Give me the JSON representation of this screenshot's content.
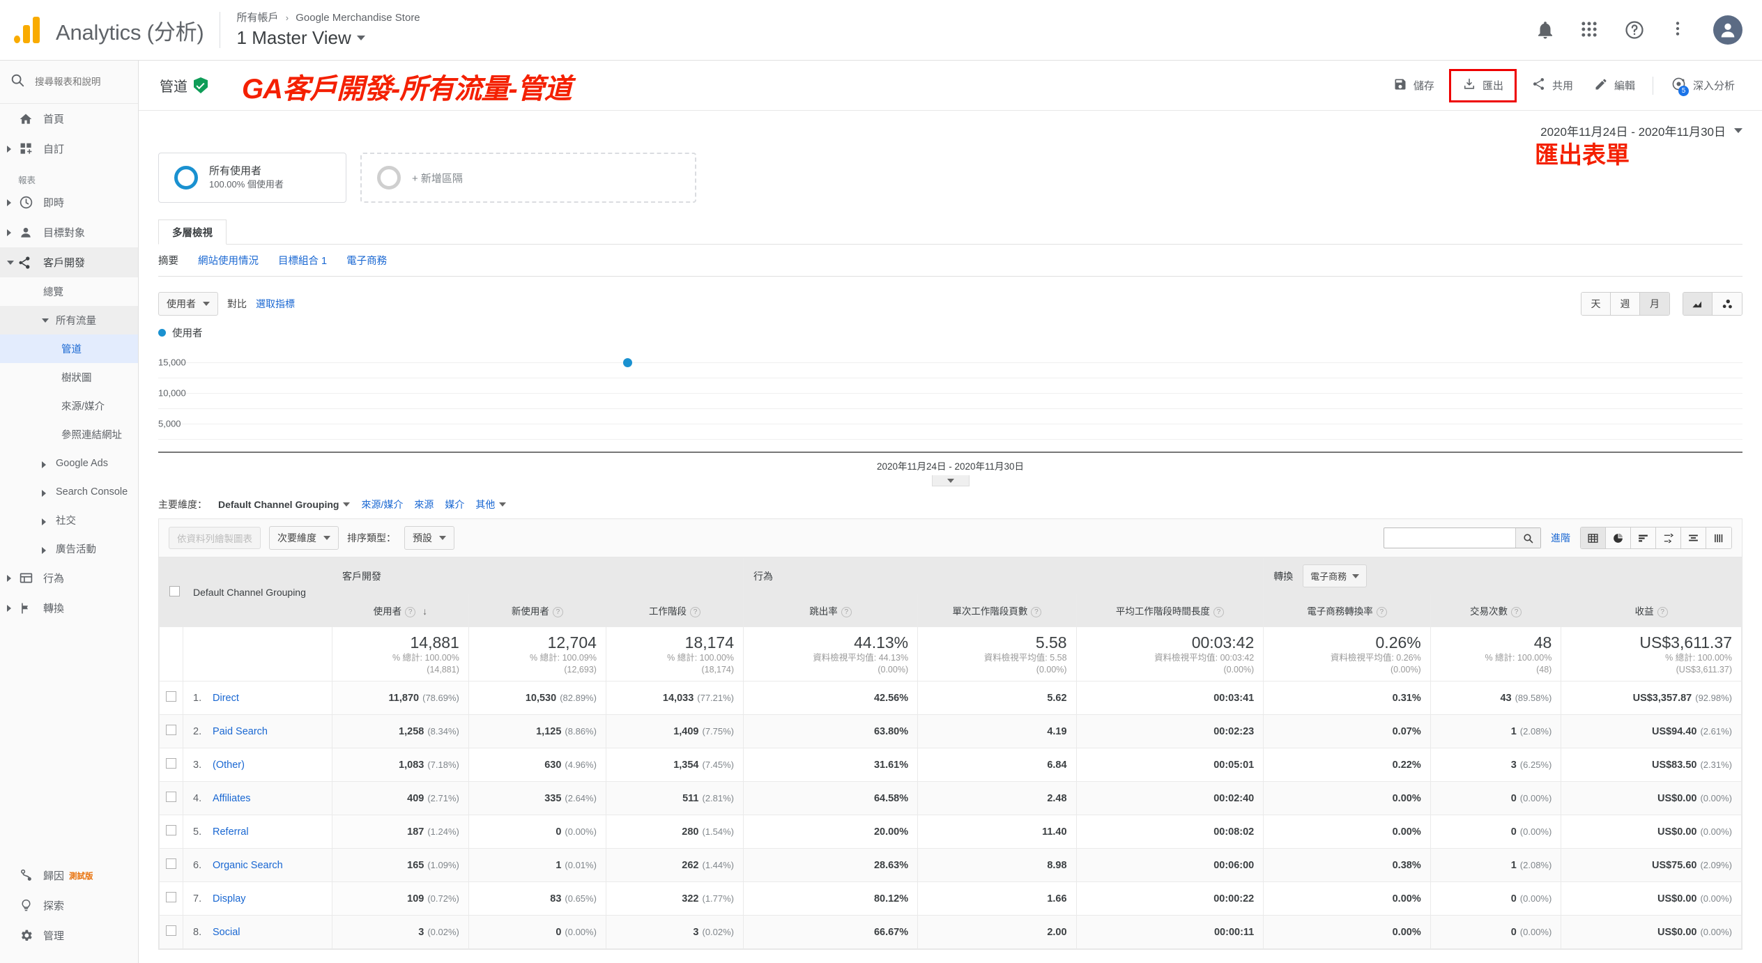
{
  "topbar": {
    "brand": "Analytics (分析)",
    "breadcrumb_root": "所有帳戶",
    "breadcrumb_sep": "›",
    "breadcrumb_property": "Google Merchandise Store",
    "view_name": "1 Master View"
  },
  "sidebar": {
    "search_placeholder": "搜尋報表和說明",
    "top_items": [
      {
        "label": "首頁",
        "icon": "home-icon",
        "expandable": false
      },
      {
        "label": "自訂",
        "icon": "custom-icon",
        "expandable": true
      }
    ],
    "section_label": "報表",
    "report_items": [
      {
        "label": "即時",
        "icon": "realtime-icon",
        "expandable": true
      },
      {
        "label": "目標對象",
        "icon": "audience-icon",
        "expandable": true
      },
      {
        "label": "客戶開發",
        "icon": "acquisition-icon",
        "expandable": true,
        "active": true
      }
    ],
    "acquisition_children": [
      {
        "label": "總覽",
        "level": 1
      },
      {
        "label": "所有流量",
        "level": 1,
        "expanded": true,
        "shaded": true
      },
      {
        "label": "管道",
        "level": 2,
        "selected": true
      },
      {
        "label": "樹狀圖",
        "level": 2
      },
      {
        "label": "來源/媒介",
        "level": 2
      },
      {
        "label": "參照連結網址",
        "level": 2
      },
      {
        "label": "Google Ads",
        "level": 1,
        "expandable": true
      },
      {
        "label": "Search Console",
        "level": 1,
        "expandable": true
      },
      {
        "label": "社交",
        "level": 1,
        "expandable": true
      },
      {
        "label": "廣告活動",
        "level": 1,
        "expandable": true
      }
    ],
    "bottom_report_items": [
      {
        "label": "行為",
        "icon": "behavior-icon",
        "expandable": true
      },
      {
        "label": "轉換",
        "icon": "conversions-icon",
        "expandable": true
      }
    ],
    "footer_items": [
      {
        "label": "歸因",
        "icon": "attribution-icon",
        "badge": "測試版"
      },
      {
        "label": "探索",
        "icon": "discover-icon",
        "badge": ""
      },
      {
        "label": "管理",
        "icon": "admin-icon",
        "badge": ""
      }
    ]
  },
  "report": {
    "title": "管道",
    "verified_icon": "shield-check-icon",
    "annotation_title": "GA客戶開發-所有流量-管道",
    "annotation_export": "匯出表單",
    "actions": [
      {
        "label": "儲存",
        "icon": "save-icon"
      },
      {
        "label": "匯出",
        "icon": "export-icon",
        "highlighted": true
      },
      {
        "label": "共用",
        "icon": "share-icon"
      },
      {
        "label": "編輯",
        "icon": "edit-icon"
      },
      {
        "label": "深入分析",
        "icon": "insights-icon",
        "badge": "5"
      }
    ],
    "date_range": "2020年11月24日 - 2020年11月30日"
  },
  "segments": [
    {
      "name": "所有使用者",
      "sub": "100.00% 個使用者"
    },
    {
      "add_label": "+ 新增區隔"
    }
  ],
  "tabs": {
    "main_tab": "多層檢視",
    "sub_tabs": [
      {
        "label": "摘要",
        "current": true
      },
      {
        "label": "網站使用情況",
        "current": false
      },
      {
        "label": "目標組合 1",
        "current": false
      },
      {
        "label": "電子商務",
        "current": false
      }
    ]
  },
  "chart_controls": {
    "metric_select": "使用者",
    "compare_label": "對比",
    "select_metric_link": "選取指標",
    "granularity": [
      {
        "label": "天",
        "active": false
      },
      {
        "label": "週",
        "active": false
      },
      {
        "label": "月",
        "active": true
      }
    ],
    "chart_type_buttons": [
      {
        "icon": "line-chart-icon",
        "active": true
      },
      {
        "icon": "scatter-plot-icon",
        "active": false
      }
    ],
    "legend_label": "使用者"
  },
  "chart_data": {
    "type": "line",
    "title": "",
    "xlabel": "",
    "ylabel": "使用者",
    "series": [
      {
        "name": "使用者",
        "values": [
          14881
        ],
        "color": "#1a91d0"
      }
    ],
    "x": [
      "2020年11月24日 - 2020年11月30日"
    ],
    "xtick_labels": [
      "2020年11月24日 - 2020年11月30日"
    ],
    "ytick_labels": [
      "5,000",
      "10,000",
      "15,000"
    ],
    "ytick_values": [
      5000,
      10000,
      15000
    ],
    "ylim": [
      0,
      17500
    ],
    "grid": true,
    "legend_position": "top-left"
  },
  "primary_dimension": {
    "label": "主要維度：",
    "current": "Default Channel Grouping",
    "alternatives": [
      "來源/媒介",
      "來源",
      "媒介",
      "其他"
    ]
  },
  "table_controls": {
    "plot_rows_label": "依資料列繪製圖表",
    "secondary_dimension": "次要維度",
    "sort_type_label": "排序類型：",
    "sort_type_value": "預設",
    "search_value": "",
    "advanced_link": "進階",
    "view_modes": [
      {
        "icon": "table-view-icon",
        "active": true
      },
      {
        "icon": "pie-view-icon",
        "active": false
      },
      {
        "icon": "bar-view-icon",
        "active": false
      },
      {
        "icon": "comparison-view-icon",
        "active": false
      },
      {
        "icon": "pivot-view-icon",
        "active": false
      },
      {
        "icon": "performance-view-icon",
        "active": false
      }
    ]
  },
  "table": {
    "dimension_header": "Default Channel Grouping",
    "groups": [
      {
        "label": "客戶開發",
        "span": 3
      },
      {
        "label": "行為",
        "span": 3
      },
      {
        "label": "轉換",
        "span": 3,
        "selector": "電子商務"
      }
    ],
    "metric_headers": [
      {
        "label": "使用者",
        "sorted": true
      },
      {
        "label": "新使用者",
        "sorted": false
      },
      {
        "label": "工作階段",
        "sorted": false
      },
      {
        "label": "跳出率",
        "sorted": false
      },
      {
        "label": "單次工作階段頁數",
        "sorted": false
      },
      {
        "label": "平均工作階段時間長度",
        "sorted": false
      },
      {
        "label": "電子商務轉換率",
        "sorted": false
      },
      {
        "label": "交易次數",
        "sorted": false
      },
      {
        "label": "收益",
        "sorted": false
      }
    ],
    "totals": [
      {
        "value": "14,881",
        "sub1": "% 總計: 100.00%",
        "sub2": "(14,881)"
      },
      {
        "value": "12,704",
        "sub1": "% 總計: 100.09%",
        "sub2": "(12,693)"
      },
      {
        "value": "18,174",
        "sub1": "% 總計: 100.00%",
        "sub2": "(18,174)"
      },
      {
        "value": "44.13%",
        "sub1": "資料檢視平均值: 44.13%",
        "sub2": "(0.00%)"
      },
      {
        "value": "5.58",
        "sub1": "資料檢視平均值: 5.58",
        "sub2": "(0.00%)"
      },
      {
        "value": "00:03:42",
        "sub1": "資料檢視平均值: 00:03:42",
        "sub2": "(0.00%)"
      },
      {
        "value": "0.26%",
        "sub1": "資料檢視平均值: 0.26%",
        "sub2": "(0.00%)"
      },
      {
        "value": "48",
        "sub1": "% 總計: 100.00%",
        "sub2": "(48)"
      },
      {
        "value": "US$3,611.37",
        "sub1": "% 總計: 100.00%",
        "sub2": "(US$3,611.37)"
      }
    ],
    "rows": [
      {
        "index": "1.",
        "name": "Direct",
        "cells": [
          {
            "v": "11,870",
            "p": "(78.69%)"
          },
          {
            "v": "10,530",
            "p": "(82.89%)"
          },
          {
            "v": "14,033",
            "p": "(77.21%)"
          },
          {
            "v": "42.56%",
            "p": ""
          },
          {
            "v": "5.62",
            "p": ""
          },
          {
            "v": "00:03:41",
            "p": ""
          },
          {
            "v": "0.31%",
            "p": ""
          },
          {
            "v": "43",
            "p": "(89.58%)"
          },
          {
            "v": "US$3,357.87",
            "p": "(92.98%)"
          }
        ]
      },
      {
        "index": "2.",
        "name": "Paid Search",
        "cells": [
          {
            "v": "1,258",
            "p": "(8.34%)"
          },
          {
            "v": "1,125",
            "p": "(8.86%)"
          },
          {
            "v": "1,409",
            "p": "(7.75%)"
          },
          {
            "v": "63.80%",
            "p": ""
          },
          {
            "v": "4.19",
            "p": ""
          },
          {
            "v": "00:02:23",
            "p": ""
          },
          {
            "v": "0.07%",
            "p": ""
          },
          {
            "v": "1",
            "p": "(2.08%)"
          },
          {
            "v": "US$94.40",
            "p": "(2.61%)"
          }
        ]
      },
      {
        "index": "3.",
        "name": "(Other)",
        "cells": [
          {
            "v": "1,083",
            "p": "(7.18%)"
          },
          {
            "v": "630",
            "p": "(4.96%)"
          },
          {
            "v": "1,354",
            "p": "(7.45%)"
          },
          {
            "v": "31.61%",
            "p": ""
          },
          {
            "v": "6.84",
            "p": ""
          },
          {
            "v": "00:05:01",
            "p": ""
          },
          {
            "v": "0.22%",
            "p": ""
          },
          {
            "v": "3",
            "p": "(6.25%)"
          },
          {
            "v": "US$83.50",
            "p": "(2.31%)"
          }
        ]
      },
      {
        "index": "4.",
        "name": "Affiliates",
        "cells": [
          {
            "v": "409",
            "p": "(2.71%)"
          },
          {
            "v": "335",
            "p": "(2.64%)"
          },
          {
            "v": "511",
            "p": "(2.81%)"
          },
          {
            "v": "64.58%",
            "p": ""
          },
          {
            "v": "2.48",
            "p": ""
          },
          {
            "v": "00:02:40",
            "p": ""
          },
          {
            "v": "0.00%",
            "p": ""
          },
          {
            "v": "0",
            "p": "(0.00%)"
          },
          {
            "v": "US$0.00",
            "p": "(0.00%)"
          }
        ]
      },
      {
        "index": "5.",
        "name": "Referral",
        "cells": [
          {
            "v": "187",
            "p": "(1.24%)"
          },
          {
            "v": "0",
            "p": "(0.00%)"
          },
          {
            "v": "280",
            "p": "(1.54%)"
          },
          {
            "v": "20.00%",
            "p": ""
          },
          {
            "v": "11.40",
            "p": ""
          },
          {
            "v": "00:08:02",
            "p": ""
          },
          {
            "v": "0.00%",
            "p": ""
          },
          {
            "v": "0",
            "p": "(0.00%)"
          },
          {
            "v": "US$0.00",
            "p": "(0.00%)"
          }
        ]
      },
      {
        "index": "6.",
        "name": "Organic Search",
        "cells": [
          {
            "v": "165",
            "p": "(1.09%)"
          },
          {
            "v": "1",
            "p": "(0.01%)"
          },
          {
            "v": "262",
            "p": "(1.44%)"
          },
          {
            "v": "28.63%",
            "p": ""
          },
          {
            "v": "8.98",
            "p": ""
          },
          {
            "v": "00:06:00",
            "p": ""
          },
          {
            "v": "0.38%",
            "p": ""
          },
          {
            "v": "1",
            "p": "(2.08%)"
          },
          {
            "v": "US$75.60",
            "p": "(2.09%)"
          }
        ]
      },
      {
        "index": "7.",
        "name": "Display",
        "cells": [
          {
            "v": "109",
            "p": "(0.72%)"
          },
          {
            "v": "83",
            "p": "(0.65%)"
          },
          {
            "v": "322",
            "p": "(1.77%)"
          },
          {
            "v": "80.12%",
            "p": ""
          },
          {
            "v": "1.66",
            "p": ""
          },
          {
            "v": "00:00:22",
            "p": ""
          },
          {
            "v": "0.00%",
            "p": ""
          },
          {
            "v": "0",
            "p": "(0.00%)"
          },
          {
            "v": "US$0.00",
            "p": "(0.00%)"
          }
        ]
      },
      {
        "index": "8.",
        "name": "Social",
        "cells": [
          {
            "v": "3",
            "p": "(0.02%)"
          },
          {
            "v": "0",
            "p": "(0.00%)"
          },
          {
            "v": "3",
            "p": "(0.02%)"
          },
          {
            "v": "66.67%",
            "p": ""
          },
          {
            "v": "2.00",
            "p": ""
          },
          {
            "v": "00:00:11",
            "p": ""
          },
          {
            "v": "0.00%",
            "p": ""
          },
          {
            "v": "0",
            "p": "(0.00%)"
          },
          {
            "v": "US$0.00",
            "p": "(0.00%)"
          }
        ]
      }
    ]
  },
  "colors": {
    "accent": "#1a73e8",
    "link": "#1967d2",
    "annotation": "#f42000",
    "series": "#1a91d0",
    "brand_orange": "#F9AB00",
    "verified_green": "#0f9d58",
    "beta_orange": "#e8710a"
  }
}
